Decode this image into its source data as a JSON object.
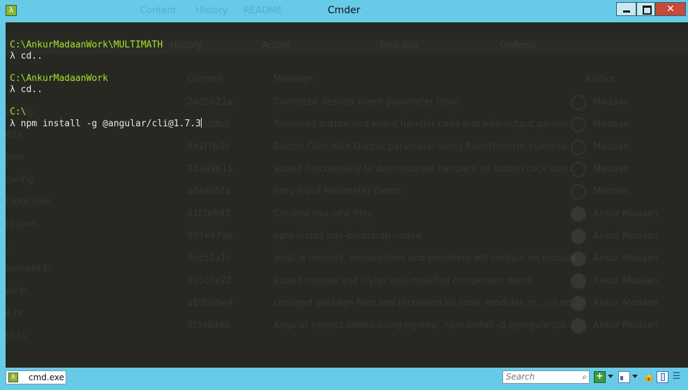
{
  "window": {
    "title": "Cmder",
    "ghost_tabs": [
      "Content",
      "History",
      "README"
    ]
  },
  "console": {
    "lines": [
      {
        "kind": "path",
        "text": "C:\\AnkurMadaanWork\\MULTIMATH"
      },
      {
        "kind": "prompt",
        "text": "λ cd.."
      },
      {
        "kind": "path",
        "text": "C:\\AnkurMadaanWork"
      },
      {
        "kind": "prompt",
        "text": "λ cd.."
      },
      {
        "kind": "path",
        "text": "C:\\"
      },
      {
        "kind": "prompt",
        "text": "λ npm install -g @angular/cli@1.7.3"
      }
    ]
  },
  "ghost": {
    "filters": [
      "History",
      "Active",
      "Find ado",
      "OnRepo"
    ],
    "columns": [
      "Commit",
      "Message",
      "Author"
    ],
    "sidebar": [
      "config",
      "e2e",
      "json",
      "config",
      "l-lock.json",
      "nt.json",
      "...",
      "onment.ts",
      "eb.ts",
      "e.ts",
      "nt.ts"
    ],
    "rows": [
      {
        "hash": "2ad5b21a",
        "message": "Corrected desired event parameter input",
        "author": "Madaan"
      },
      {
        "hash": "7cf3d8b0",
        "message": "Removed button and event handler code and also output param...",
        "author": "Madaan"
      },
      {
        "hash": "9e1f7b4c",
        "message": "Button Click with Output parameter using EventEmitter event ca...",
        "author": "Madaan"
      },
      {
        "hash": "71a09611",
        "message": "added functionality to demonstrate handlers on button click usin...",
        "author": "Madaan"
      },
      {
        "hash": "d8e4b5fa",
        "message": "Intro Input Parameter Demo",
        "author": "Madaan"
      },
      {
        "hash": "81f7e692",
        "message": "Created two new files",
        "author": "Ankur Madaan"
      },
      {
        "hash": "997e47ae",
        "message": "npm install ngx-bootstrap --save",
        "author": "Ankur Madaan"
      },
      {
        "hash": "3bc51a1c",
        "message": "what is imports, declarations and providers will contain on module",
        "author": "Ankur Madaan"
      },
      {
        "hash": "6e5c0e22",
        "message": "added images and styles and modified component name",
        "author": "Ankur Madaan"
      },
      {
        "hash": "a19b09e4",
        "message": "changed package files and recreated all node_modules m... cli no...",
        "author": "Ankur Madaan"
      },
      {
        "hash": "8f3e8a4b",
        "message": "Angular project added using ng new, npm install -g @angular/cli...",
        "author": "Ankur Madaan"
      }
    ]
  },
  "statusbar": {
    "tab_label": "cmd.exe",
    "search_placeholder": "Search"
  },
  "icons": {
    "app": "lambda-icon",
    "add": "plus-icon",
    "lock": "lock-icon"
  },
  "colors": {
    "chrome": "#67cbe7",
    "console_bg": "#272822",
    "path": "#a6e22e",
    "text": "#e8e8e8"
  }
}
